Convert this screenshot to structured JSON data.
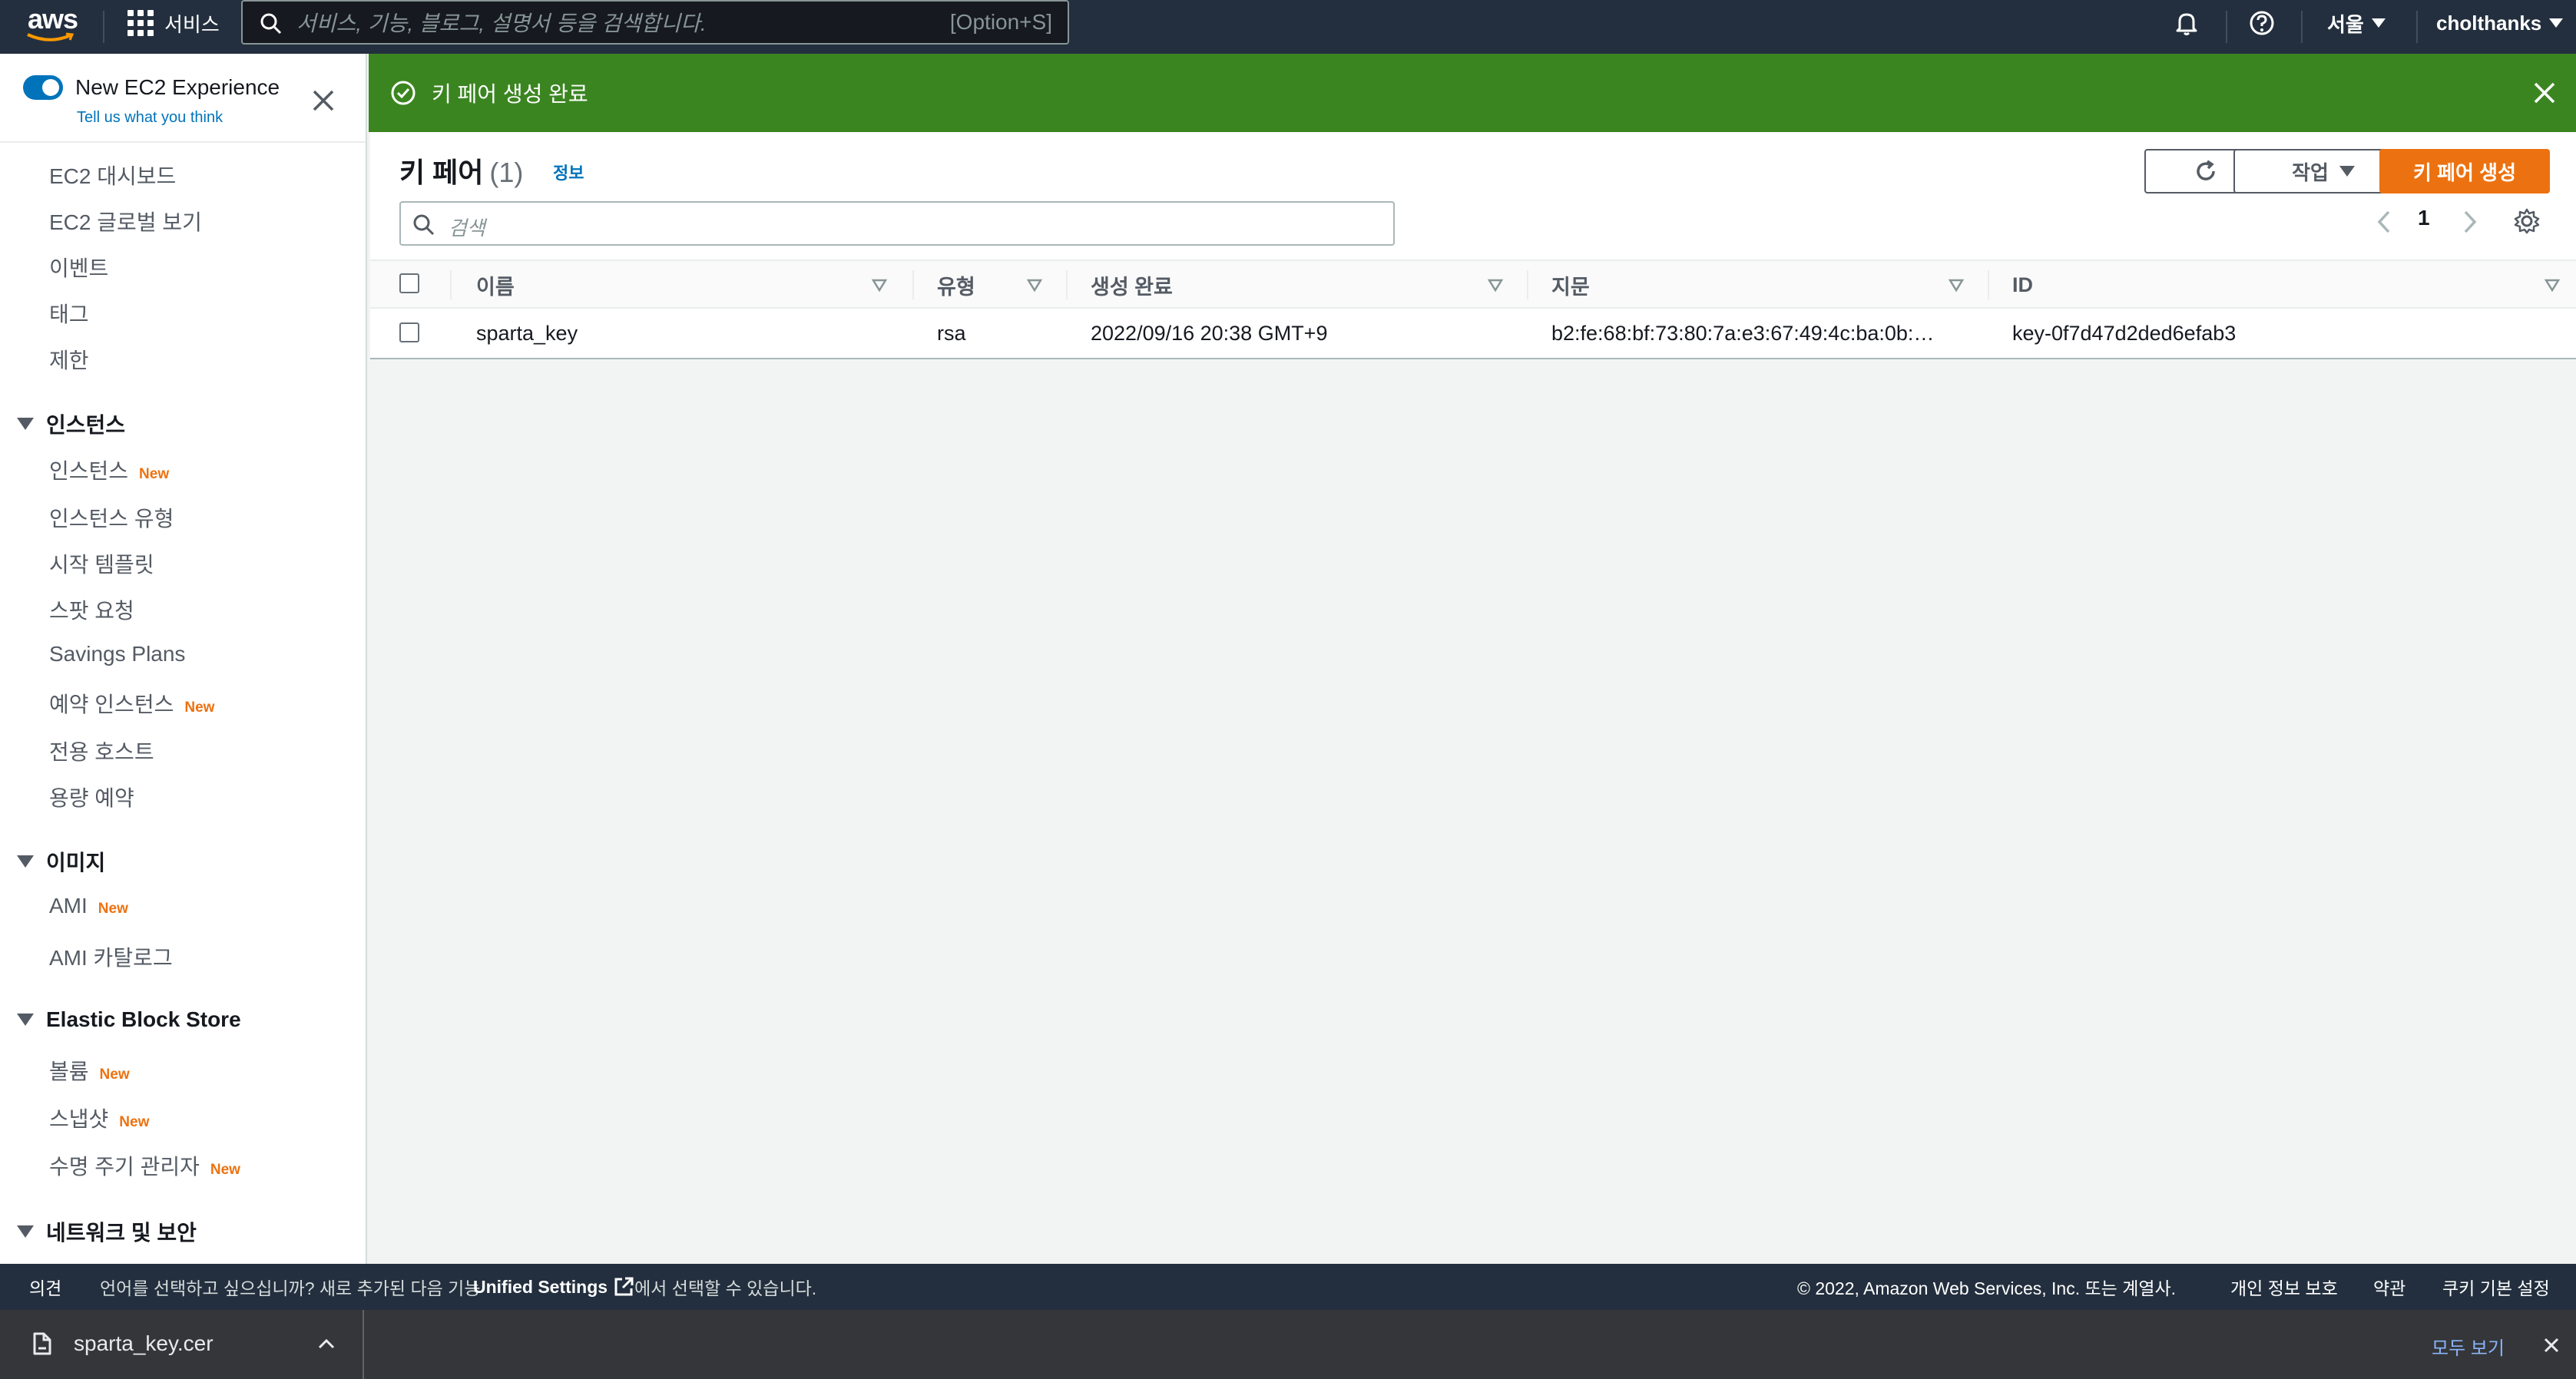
{
  "topnav": {
    "logo": "aws",
    "services_label": "서비스",
    "search_placeholder": "서비스, 기능, 블로그, 설명서 등을 검색합니다.",
    "search_shortcut": "[Option+S]",
    "region": "서울",
    "user": "cholthanks",
    "icons": [
      "bell-icon",
      "help-icon"
    ]
  },
  "sidebar": {
    "toggle_label": "New EC2 Experience",
    "feedback_link": "Tell us what you think",
    "items_top": [
      "EC2 대시보드",
      "EC2 글로벌 보기",
      "이벤트",
      "태그",
      "제한"
    ],
    "sections": {
      "instances": {
        "title": "인스턴스",
        "items": [
          "인스턴스",
          "인스턴스 유형",
          "시작 템플릿",
          "스팟 요청",
          "Savings Plans",
          "예약 인스턴스",
          "전용 호스트",
          "용량 예약"
        ]
      },
      "images": {
        "title": "이미지",
        "items": [
          "AMI",
          "AMI 카탈로그"
        ]
      },
      "ebs": {
        "title": "Elastic Block Store",
        "items": [
          "볼륨",
          "스냅샷",
          "수명 주기 관리자"
        ]
      },
      "network": {
        "title": "네트워크 및 보안"
      }
    },
    "new_badge": "New"
  },
  "flash": {
    "message": "키 페어 생성 완료",
    "color": "#3b8521"
  },
  "panel": {
    "title": "키 페어",
    "count": "(1)",
    "info": "정보",
    "actions_label": "작업",
    "create_label": "키 페어 생성",
    "search_placeholder": "검색",
    "page": "1",
    "columns": [
      "이름",
      "유형",
      "생성 완료",
      "지문",
      "ID"
    ],
    "rows": [
      {
        "name": "sparta_key",
        "type": "rsa",
        "created": "2022/09/16 20:38 GMT+9",
        "fingerprint": "b2:fe:68:bf:73:80:7a:e3:67:49:4c:ba:0b:…",
        "id": "key-0f7d47d2ded6efab3"
      }
    ]
  },
  "footer": {
    "feedback": "의견",
    "language_prefix": "언어를 선택하고 싶으십니까? 새로 추가된 다음 기능",
    "unified_settings": "Unified Settings",
    "language_suffix": "에서 선택할 수 있습니다.",
    "copyright": "© 2022, Amazon Web Services, Inc. 또는 계열사.",
    "privacy": "개인 정보 보호",
    "terms": "약관",
    "cookies": "쿠키 기본 설정"
  },
  "downloads": {
    "file_name": "sparta_key.cer",
    "show_all": "모두 보기"
  },
  "colors": {
    "nav_bg": "#232f3e",
    "accent_orange": "#ec7211",
    "link_blue": "#0073bb",
    "success_green": "#3b8521"
  }
}
